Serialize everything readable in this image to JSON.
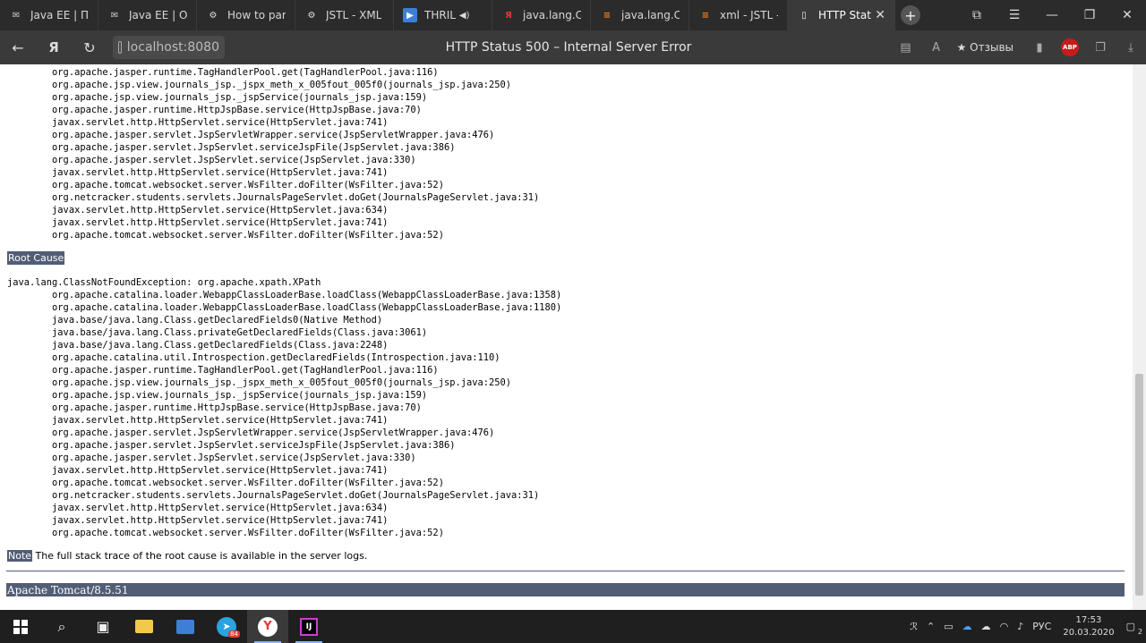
{
  "tabs": [
    {
      "label": "Java EE | Пер",
      "icon": "mail-icon",
      "active": false
    },
    {
      "label": "Java EE | Ос",
      "icon": "mail-icon",
      "active": false
    },
    {
      "label": "How to pars",
      "icon": "gear-icon",
      "active": false
    },
    {
      "label": "JSTL - XML",
      "icon": "gear-icon",
      "active": false
    },
    {
      "label": "THRIL",
      "icon": "video-icon",
      "active": false
    },
    {
      "label": "java.lang.Cla",
      "icon": "yandex-icon",
      "active": false
    },
    {
      "label": "java.lang.Cla",
      "icon": "stack-icon",
      "active": false
    },
    {
      "label": "xml - JSTL -",
      "icon": "stack-icon",
      "active": false
    },
    {
      "label": "HTTP Stat",
      "icon": "page-icon",
      "active": true
    }
  ],
  "address": {
    "url": "localhost:8080"
  },
  "page_title": "HTTP Status 500 – Internal Server Error",
  "toolbar": {
    "reviews_label": "★ Отзывы",
    "abp_label": "ABP"
  },
  "trace_top": "        org.apache.jasper.runtime.TagHandlerPool.get(TagHandlerPool.java:116)\n        org.apache.jsp.view.journals_jsp._jspx_meth_x_005fout_005f0(journals_jsp.java:250)\n        org.apache.jsp.view.journals_jsp._jspService(journals_jsp.java:159)\n        org.apache.jasper.runtime.HttpJspBase.service(HttpJspBase.java:70)\n        javax.servlet.http.HttpServlet.service(HttpServlet.java:741)\n        org.apache.jasper.servlet.JspServletWrapper.service(JspServletWrapper.java:476)\n        org.apache.jasper.servlet.JspServlet.serviceJspFile(JspServlet.java:386)\n        org.apache.jasper.servlet.JspServlet.service(JspServlet.java:330)\n        javax.servlet.http.HttpServlet.service(HttpServlet.java:741)\n        org.apache.tomcat.websocket.server.WsFilter.doFilter(WsFilter.java:52)\n        org.netcracker.students.servlets.JournalsPageServlet.doGet(JournalsPageServlet.java:31)\n        javax.servlet.http.HttpServlet.service(HttpServlet.java:634)\n        javax.servlet.http.HttpServlet.service(HttpServlet.java:741)\n        org.apache.tomcat.websocket.server.WsFilter.doFilter(WsFilter.java:52)",
  "root_cause_heading": "Root Cause",
  "trace_root": "java.lang.ClassNotFoundException: org.apache.xpath.XPath\n        org.apache.catalina.loader.WebappClassLoaderBase.loadClass(WebappClassLoaderBase.java:1358)\n        org.apache.catalina.loader.WebappClassLoaderBase.loadClass(WebappClassLoaderBase.java:1180)\n        java.base/java.lang.Class.getDeclaredFields0(Native Method)\n        java.base/java.lang.Class.privateGetDeclaredFields(Class.java:3061)\n        java.base/java.lang.Class.getDeclaredFields(Class.java:2248)\n        org.apache.catalina.util.Introspection.getDeclaredFields(Introspection.java:110)\n        org.apache.jasper.runtime.TagHandlerPool.get(TagHandlerPool.java:116)\n        org.apache.jsp.view.journals_jsp._jspx_meth_x_005fout_005f0(journals_jsp.java:250)\n        org.apache.jsp.view.journals_jsp._jspService(journals_jsp.java:159)\n        org.apache.jasper.runtime.HttpJspBase.service(HttpJspBase.java:70)\n        javax.servlet.http.HttpServlet.service(HttpServlet.java:741)\n        org.apache.jasper.servlet.JspServletWrapper.service(JspServletWrapper.java:476)\n        org.apache.jasper.servlet.JspServlet.serviceJspFile(JspServlet.java:386)\n        org.apache.jasper.servlet.JspServlet.service(JspServlet.java:330)\n        javax.servlet.http.HttpServlet.service(HttpServlet.java:741)\n        org.apache.tomcat.websocket.server.WsFilter.doFilter(WsFilter.java:52)\n        org.netcracker.students.servlets.JournalsPageServlet.doGet(JournalsPageServlet.java:31)\n        javax.servlet.http.HttpServlet.service(HttpServlet.java:634)\n        javax.servlet.http.HttpServlet.service(HttpServlet.java:741)\n        org.apache.tomcat.websocket.server.WsFilter.doFilter(WsFilter.java:52)",
  "note": {
    "label": "Note",
    "text": " The full stack trace of the root cause is available in the server logs."
  },
  "footer": "Apache Tomcat/8.5.51",
  "taskbar": {
    "telegram_badge": "84",
    "tray_lang": "РУС",
    "time": "17:53",
    "date": "20.03.2020",
    "notif_count": "2"
  },
  "colors": {
    "tomcat_accent": "#525D76",
    "tab_bg": "#2b2b2b",
    "navbar_bg": "#3a3a3a"
  }
}
